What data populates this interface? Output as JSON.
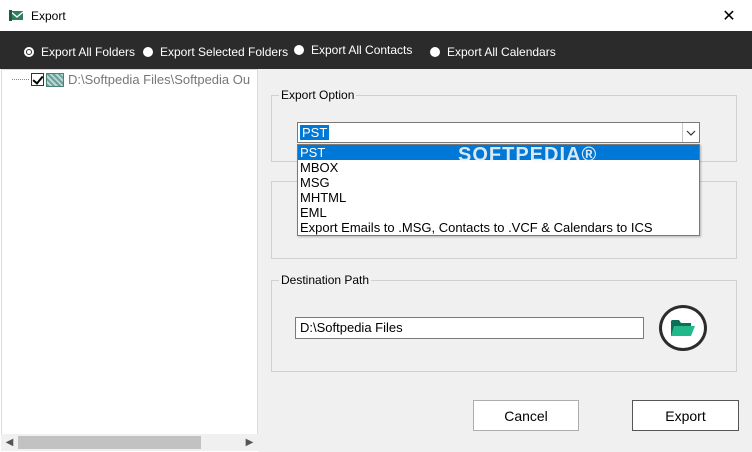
{
  "window": {
    "title": "Export",
    "close_glyph": "✕",
    "app_icon": "export-app-icon"
  },
  "export_modes": [
    {
      "label": "Export All Folders",
      "selected": true
    },
    {
      "label": "Export Selected Folders",
      "selected": false
    },
    {
      "label": "Export All Contacts",
      "selected": false
    },
    {
      "label": "Export All Calendars",
      "selected": false
    }
  ],
  "tree": {
    "root_label": "D:\\Softpedia Files\\Softpedia Ou",
    "checked": true
  },
  "scrollbar": {
    "left_arrow": "◀",
    "right_arrow": "▶"
  },
  "export_option": {
    "legend": "Export Option",
    "selected_value": "PST",
    "options": [
      "PST",
      "MBOX",
      "MSG",
      "MHTML",
      "EML",
      "Export Emails to .MSG, Contacts to .VCF & Calendars to ICS"
    ]
  },
  "destination": {
    "legend": "Destination Path",
    "path_value": "D:\\Softpedia Files"
  },
  "buttons": {
    "cancel_label": "Cancel",
    "export_label": "Export"
  },
  "watermark": "SOFTPEDIA®",
  "colors": {
    "radio_bar": "#2b2b2b",
    "selection": "#0078d7",
    "folder_icon": "#1f9e7a"
  }
}
